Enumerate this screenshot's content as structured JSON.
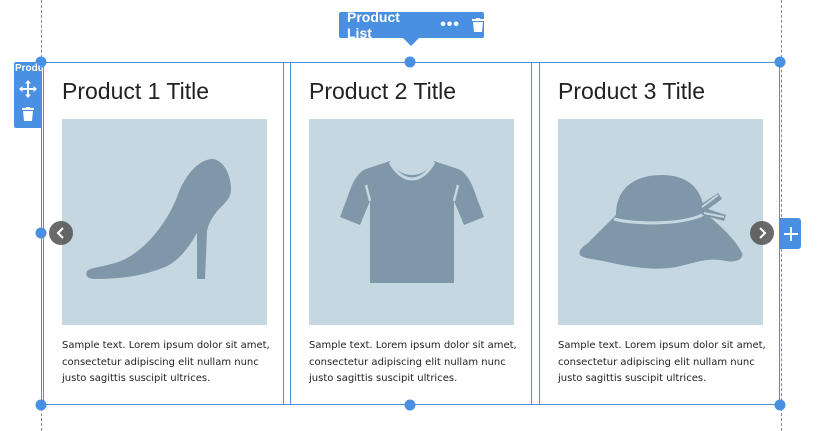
{
  "component": {
    "label": "Product List",
    "side_label": "Product List"
  },
  "products": [
    {
      "title": "Product 1 Title",
      "image_icon": "high-heel-shoe-icon",
      "text": "Sample text. Lorem ipsum dolor sit amet, consectetur adipiscing elit nullam nunc justo sagittis suscipit ultrices."
    },
    {
      "title": "Product 2 Title",
      "image_icon": "t-shirt-icon",
      "text": "Sample text. Lorem ipsum dolor sit amet, consectetur adipiscing elit nullam nunc justo sagittis suscipit ultrices."
    },
    {
      "title": "Product 3 Title",
      "image_icon": "sun-hat-icon",
      "text": "Sample text. Lorem ipsum dolor sit amet, consectetur adipiscing elit nullam nunc justo sagittis suscipit ultrices."
    }
  ],
  "colors": {
    "accent": "#4a90e2",
    "image_bg": "#c5d7e0",
    "image_icon": "#7f97a8"
  }
}
